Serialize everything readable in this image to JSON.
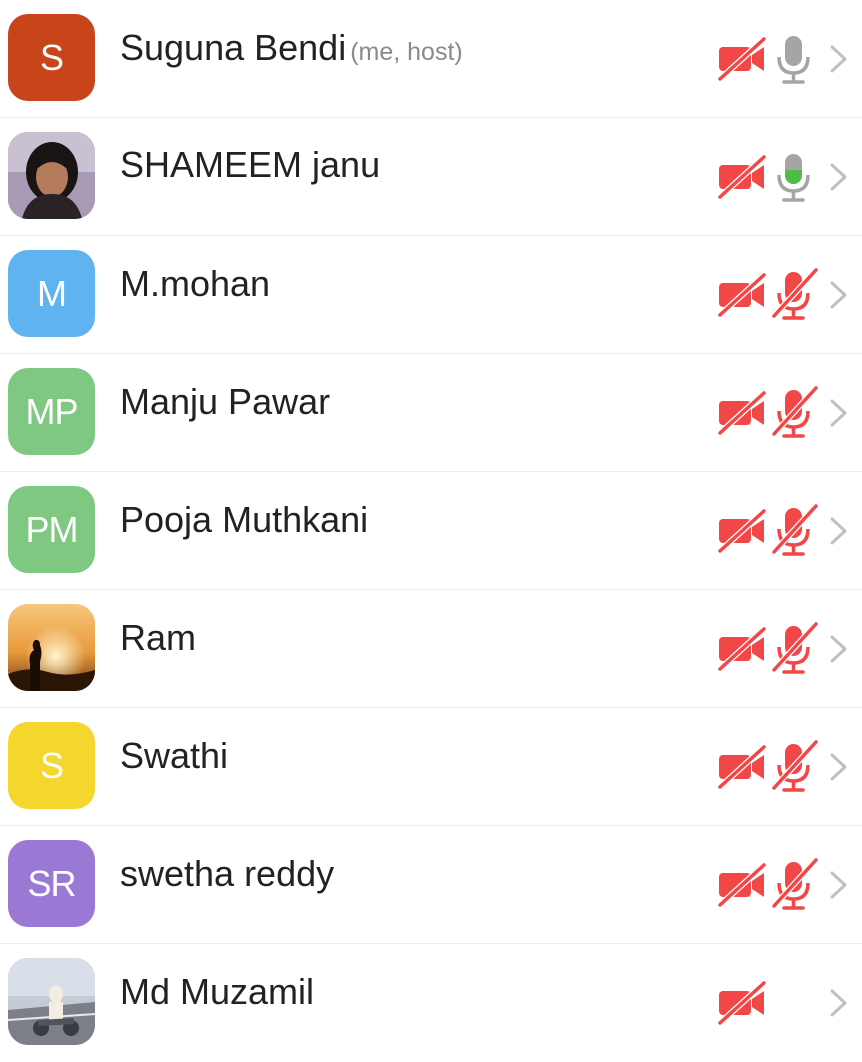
{
  "participants": [
    {
      "name": "Suguna Bendi",
      "tag": "(me, host)",
      "initials": "S",
      "avatar_color": "#c8451c",
      "avatar_type": "initials",
      "video": "off",
      "mic": "on"
    },
    {
      "name": "SHAMEEM janu",
      "tag": "",
      "initials": "",
      "avatar_color": "#8a7e96",
      "avatar_type": "photo-portrait",
      "video": "off",
      "mic": "speaking"
    },
    {
      "name": "M.mohan",
      "tag": "",
      "initials": "M",
      "avatar_color": "#5eb3f0",
      "avatar_type": "initials",
      "video": "off",
      "mic": "muted"
    },
    {
      "name": "Manju Pawar",
      "tag": "",
      "initials": "MP",
      "avatar_color": "#7ec882",
      "avatar_type": "initials",
      "video": "off",
      "mic": "muted"
    },
    {
      "name": "Pooja Muthkani",
      "tag": "",
      "initials": "PM",
      "avatar_color": "#7ec882",
      "avatar_type": "initials",
      "video": "off",
      "mic": "muted"
    },
    {
      "name": "Ram",
      "tag": "",
      "initials": "",
      "avatar_color": "#e9a64a",
      "avatar_type": "photo-sunset",
      "video": "off",
      "mic": "muted"
    },
    {
      "name": "Swathi",
      "tag": "",
      "initials": "S",
      "avatar_color": "#f4d62d",
      "avatar_type": "initials",
      "video": "off",
      "mic": "muted"
    },
    {
      "name": "swetha reddy",
      "tag": "",
      "initials": "SR",
      "avatar_color": "#9a79d4",
      "avatar_type": "initials",
      "video": "off",
      "mic": "muted"
    },
    {
      "name": "Md Muzamil",
      "tag": "",
      "initials": "",
      "avatar_color": "#9aa3b0",
      "avatar_type": "photo-road",
      "video": "off",
      "mic": "none"
    }
  ],
  "colors": {
    "muted_red": "#f24747",
    "mic_gray": "#a5a5a8",
    "mic_green": "#4ebd45",
    "chevron": "#bfbfc4"
  },
  "icons": {
    "video_off": "video-off-icon",
    "mic_on": "microphone-icon",
    "mic_muted": "microphone-muted-icon",
    "chevron": "chevron-right-icon"
  }
}
